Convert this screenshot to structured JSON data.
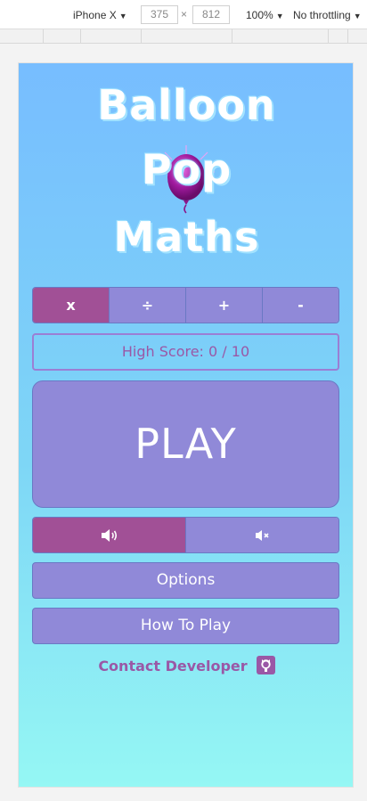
{
  "devtools": {
    "device": "iPhone X",
    "width": "375",
    "times": "×",
    "height": "812",
    "zoom": "100%",
    "throttling": "No throttling"
  },
  "app": {
    "title_line1": "Balloon",
    "title_line2": "Pop",
    "title_line3": "Maths",
    "operations": [
      {
        "label": "x",
        "selected": true
      },
      {
        "label": "÷",
        "selected": false
      },
      {
        "label": "+",
        "selected": false
      },
      {
        "label": "-",
        "selected": false
      }
    ],
    "high_score": "High Score: 0 / 10",
    "play_label": "PLAY",
    "sound": {
      "on_icon": "volume-up-icon",
      "off_icon": "volume-mute-icon",
      "selected": "on"
    },
    "options_label": "Options",
    "how_to_play_label": "How To Play",
    "contact_label": "Contact Developer",
    "contact_icon": "github-icon"
  },
  "colors": {
    "selected": "#a15096",
    "button": "#9089d8",
    "accent_text": "#9a58a6",
    "gradient_top": "#77bdff",
    "gradient_bottom": "#95f7f4"
  }
}
